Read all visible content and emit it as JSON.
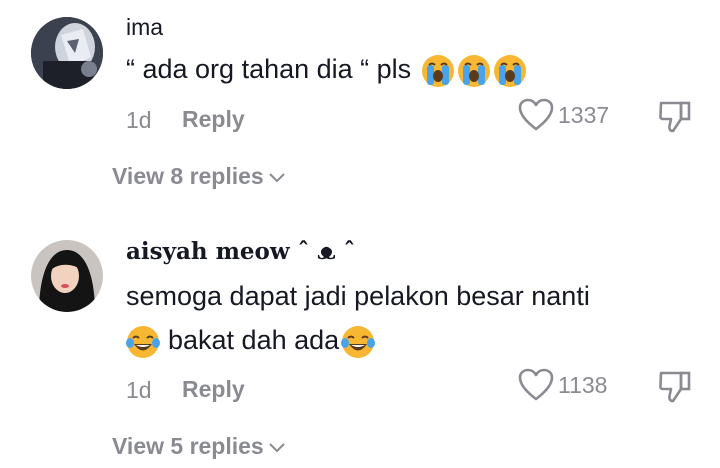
{
  "comments": [
    {
      "username": "ima",
      "text": "“ ada org tahan dia “ pls",
      "emoji": [
        "loudly-crying-face",
        "loudly-crying-face",
        "loudly-crying-face"
      ],
      "time": "1d",
      "reply_label": "Reply",
      "likes": "1337",
      "view_replies": "View 8 replies"
    },
    {
      "username": "aisyah meow ˆ ᴥ ˆ",
      "text_line1": "semoga dapat jadi pelakon besar nanti",
      "text_line2": "bakat dah ada",
      "emoji": [
        "face-with-tears-of-joy",
        "face-with-tears-of-joy"
      ],
      "time": "1d",
      "reply_label": "Reply",
      "likes": "1138",
      "view_replies": "View 5 replies"
    }
  ],
  "colors": {
    "text": "#161823",
    "muted": "#8a8b91",
    "emoji": "#f7b733"
  }
}
